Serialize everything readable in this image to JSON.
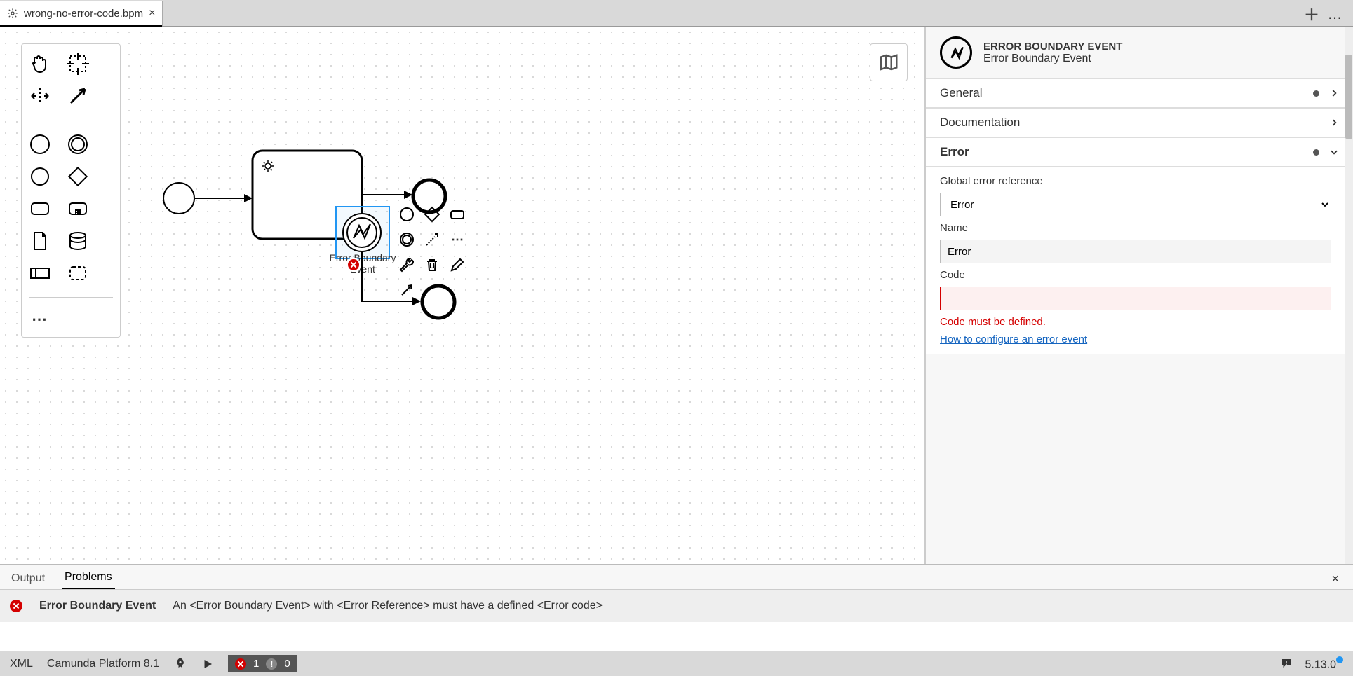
{
  "tab": {
    "filename": "wrong-no-error-code.bpm"
  },
  "canvas": {
    "boundary_label": "Error Boundary Event"
  },
  "props": {
    "type": "ERROR BOUNDARY EVENT",
    "name": "Error Boundary Event",
    "sections": {
      "general": "General",
      "documentation": "Documentation",
      "error": "Error"
    },
    "error": {
      "global_ref_label": "Global error reference",
      "global_ref_value": "Error",
      "name_label": "Name",
      "name_value": "Error",
      "code_label": "Code",
      "code_value": "",
      "code_error": "Code must be defined.",
      "help_link": "How to configure an error event"
    }
  },
  "bottom_tabs": {
    "output": "Output",
    "problems": "Problems"
  },
  "problem": {
    "title": "Error Boundary Event",
    "desc": "An <Error Boundary Event> with <Error Reference> must have a defined <Error code>"
  },
  "status": {
    "xml": "XML",
    "platform": "Camunda Platform 8.1",
    "errors": "1",
    "warnings": "0",
    "version": "5.13.0"
  }
}
